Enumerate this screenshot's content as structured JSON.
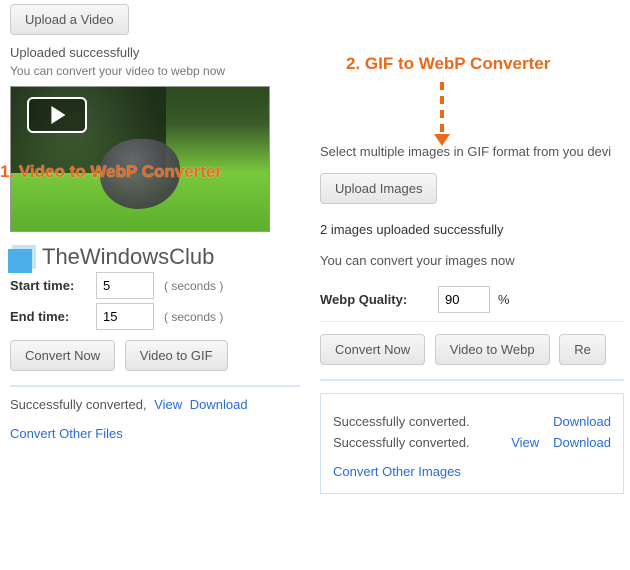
{
  "annotations": {
    "left_title": "1. Video to WebP Converter",
    "right_title": "2. GIF to WebP Converter"
  },
  "left": {
    "upload_button": "Upload a Video",
    "uploaded_status": "Uploaded successfully",
    "convert_hint": "You can convert your video to webp now",
    "start_label": "Start time:",
    "start_value": "5",
    "end_label": "End time:",
    "end_value": "15",
    "seconds_unit": "( seconds )",
    "convert_button": "Convert Now",
    "video_to_gif_button": "Video to GIF",
    "success_text": "Successfully converted,",
    "view_link": "View",
    "download_link": "Download",
    "other_files_link": "Convert Other Files"
  },
  "right": {
    "select_text": "Select multiple images in GIF format from you devi",
    "upload_button": "Upload Images",
    "uploaded_status": "2 images uploaded successfully",
    "convert_hint": "You can convert your images now",
    "quality_label": "Webp Quality:",
    "quality_value": "90",
    "percent": "%",
    "convert_button": "Convert Now",
    "video_to_webp_button": "Video to Webp",
    "reset_button": "Re",
    "rows": [
      {
        "status": "Successfully converted.",
        "view": "",
        "download": "Download"
      },
      {
        "status": "Successfully converted.",
        "view": "View",
        "download": "Download"
      }
    ],
    "other_images_link": "Convert Other Images"
  },
  "watermark": "TheWindowsClub"
}
